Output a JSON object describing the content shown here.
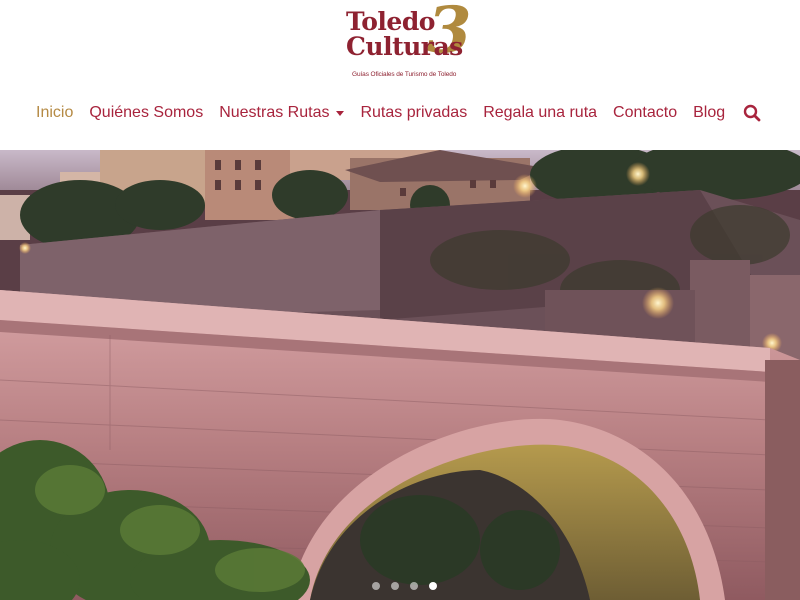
{
  "logo": {
    "line1": "Toledo",
    "line2": "Culturas",
    "numeral": "3",
    "tagline": "Guías Oficiales de Turismo de Toledo"
  },
  "nav": {
    "items": [
      {
        "label": "Inicio",
        "active": true
      },
      {
        "label": "Quiénes Somos"
      },
      {
        "label": "Nuestras Rutas",
        "dropdown": true
      },
      {
        "label": "Rutas privadas"
      },
      {
        "label": "Regala una ruta"
      },
      {
        "label": "Contacto"
      },
      {
        "label": "Blog"
      }
    ],
    "search_icon": "search-icon"
  },
  "hero": {
    "image_subject": "stone-bridge-photo",
    "slide_count": 4,
    "active_slide": 4
  },
  "colors": {
    "brand": "#a8243d",
    "active": "#b58a44",
    "logo_red": "#8e2231",
    "logo_gold": "#b08a3e"
  }
}
